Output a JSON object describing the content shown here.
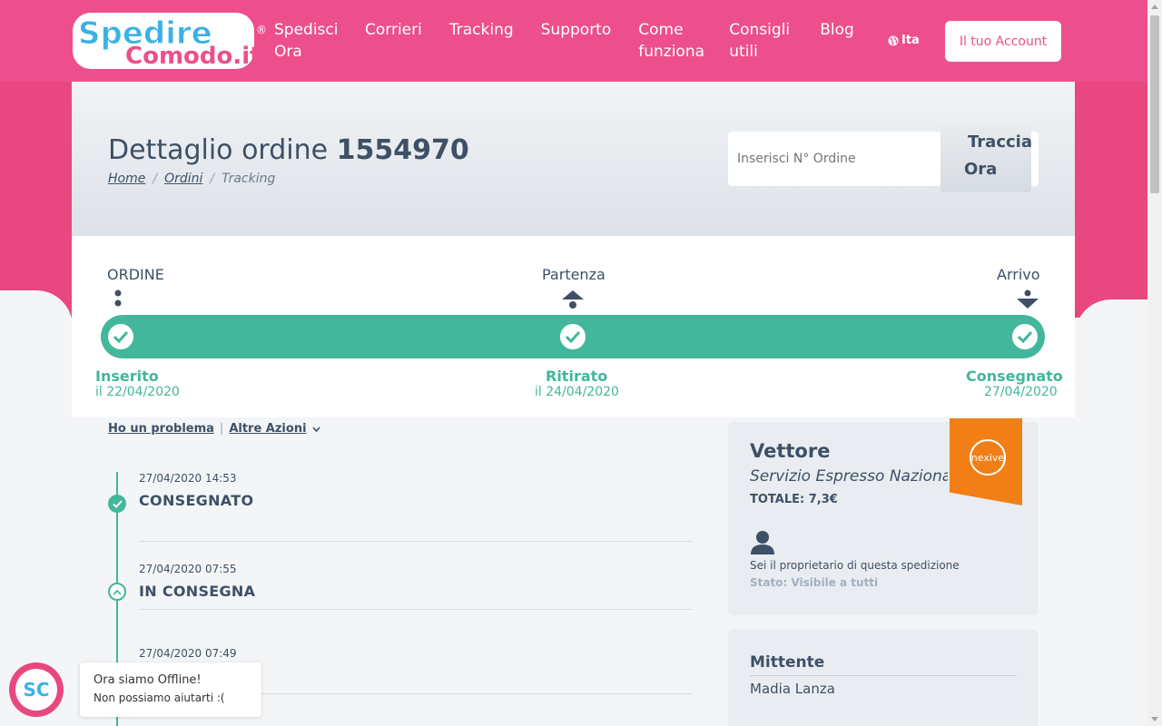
{
  "header": {
    "logo_line1": "Spedire",
    "logo_line2": "Comodo.it",
    "logo_reg": "®",
    "nav": [
      "Spedisci Ora",
      "Corrieri",
      "Tracking",
      "Supporto",
      "Come funziona",
      "Consigli utili",
      "Blog"
    ],
    "lang": "Ita",
    "account_label": "Il tuo Account"
  },
  "hero": {
    "title_prefix": "Dettaglio ordine",
    "order_number": "1554970",
    "breadcrumb": [
      "Home",
      "Ordini",
      "Tracking"
    ],
    "breadcrumb_sep": "/",
    "search_placeholder": "Inserisci N° Ordine",
    "track_button_line1": "Traccia",
    "track_button_line2": "Ora"
  },
  "progress": {
    "stage_labels": [
      "ORDINE",
      "Partenza",
      "Arrivo"
    ],
    "steps": [
      {
        "title": "Inserito",
        "date": "il 22/04/2020"
      },
      {
        "title": "Ritirato",
        "date": "il 24/04/2020"
      },
      {
        "title": "Consegnato",
        "date": "27/04/2020"
      }
    ]
  },
  "actions": {
    "problem": "Ho un problema",
    "sep": "|",
    "more": "Altre Azioni"
  },
  "events": [
    {
      "date": "27/04/2020 14:53",
      "status": "CONSEGNATO"
    },
    {
      "date": "27/04/2020 07:55",
      "status": "IN CONSEGNA"
    },
    {
      "date": "27/04/2020 07:49",
      "status": ""
    }
  ],
  "vettore": {
    "heading": "Vettore",
    "service": "Servizio Espresso Nazionale",
    "totale": "TOTALE: 7,3€",
    "brand": "nexive",
    "owner_text": "Sei il proprietario di questa spedizione",
    "stato": "Stato: Visibile a tutti"
  },
  "mittente": {
    "heading": "Mittente",
    "name": "Madia Lanza"
  },
  "chat": {
    "avatar": "SC",
    "line1": "Ora siamo Offline!",
    "line2": "Non possiamo aiutarti :("
  },
  "colors": {
    "brand_pink": "#ec4f8c",
    "accent_green": "#42b79b",
    "text_dark": "#3d5066",
    "nexive_orange": "#f17f16"
  }
}
